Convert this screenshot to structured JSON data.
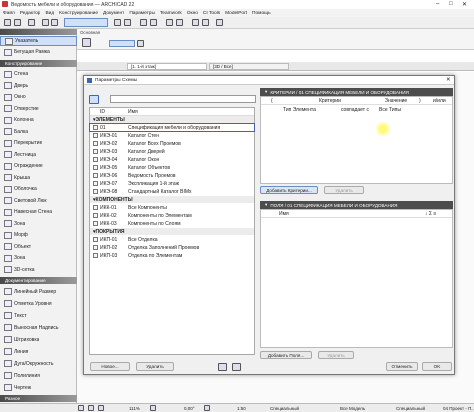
{
  "window": {
    "title": "Ведомость мебели и оборудования — ARCHICAD 22"
  },
  "menu": [
    "Файл",
    "Редактор",
    "Вид",
    "Конструирование",
    "Документ",
    "Параметры",
    "Teamwork",
    "Окно",
    "CI Tools",
    "ModelPort",
    "Помощь"
  ],
  "info_box": {
    "label": "Основная"
  },
  "tabs": [
    {
      "label": "[1. 1-й этаж]"
    },
    {
      "label": "[3D / Все]"
    }
  ],
  "toolbox": {
    "select_section": "",
    "select_items": [
      "Указатель",
      "Бегущая Рамка"
    ],
    "construct_section": "Конструирование",
    "construct_items": [
      "Стена",
      "Дверь",
      "Окно",
      "Отверстие",
      "Колонна",
      "Балка",
      "Перекрытие",
      "Лестница",
      "Ограждение",
      "Крыша",
      "Оболочка",
      "Световой Люк",
      "Навесная Стена",
      "Зона",
      "Морф",
      "Объект",
      "Зона",
      "3D-сетка"
    ],
    "document_section": "Документирование",
    "document_items": [
      "Линейный Размер",
      "Отметка Уровня",
      "Текст",
      "Выносная Надпись",
      "Штриховка",
      "Линия",
      "Дуга/Окружность",
      "Полилиния",
      "Чертеж"
    ],
    "more_label": "Разное"
  },
  "dialog": {
    "title": "Параметры Схемы",
    "left": {
      "col_id": "ID",
      "col_name": "Имя",
      "groups": [
        {
          "label": "ЭЛЕМЕНТЫ",
          "rows": [
            [
              "01",
              "Спецификация мебели и оборудования"
            ],
            [
              "ИКЭ-01",
              "Каталог Стен"
            ],
            [
              "ИКЭ-02",
              "Каталог Всех Проемов"
            ],
            [
              "ИКЭ-03",
              "Каталог Дверей"
            ],
            [
              "ИКЭ-04",
              "Каталог Окон"
            ],
            [
              "ИКЭ-05",
              "Каталог Объектов"
            ],
            [
              "ИКЭ-06",
              "Ведомость Проемов"
            ],
            [
              "ИКЭ-07",
              "Экспликация 1-й этаж"
            ],
            [
              "ИКЭ-08",
              "Стандартный Каталог BIMx"
            ]
          ]
        },
        {
          "label": "КОМПОНЕНТЫ",
          "rows": [
            [
              "ИКК-01",
              "Все Компоненты"
            ],
            [
              "ИКК-02",
              "Компоненты по Элементам"
            ],
            [
              "ИКК-03",
              "Компоненты по Слоям"
            ]
          ]
        },
        {
          "label": "ПОКРЫТИЯ",
          "rows": [
            [
              "ИКП-01",
              "Все Отделка"
            ],
            [
              "ИКП-02",
              "Отделка Заполнений Проемов"
            ],
            [
              "ИКП-03",
              "Отделка по Элементам"
            ]
          ]
        }
      ],
      "new_button": "Новое...",
      "delete_button": "Удалить"
    },
    "right": {
      "criteria_title": "КРИТЕРИИ / 01 СПЕЦИФИКАЦИЯ МЕБЕЛИ И ОБОРУДОВАНИЯ",
      "criteria_headers": [
        "(",
        "Критерии",
        "Значение",
        ")",
        "и/или"
      ],
      "criteria_row": [
        "Тип Элемента",
        "совпадает с",
        "Все Типы"
      ],
      "add_criteria_button": "Добавить Критерии...",
      "delete_criteria_button": "Удалить",
      "fields_title": "ПОЛЯ / 01 СПЕЦИФИКАЦИЯ МЕБЕЛИ И ОБОРУДОВАНИЯ",
      "fields_header": "Имя",
      "fields_header_icons": "↓ Σ ≡",
      "add_fields_button": "Добавить Поля...",
      "delete_fields_button": "Удалить",
      "cancel_button": "Отменить",
      "ok_button": "OK"
    }
  },
  "status": {
    "zoom": "111%",
    "angle": "0,00°",
    "scale": "1:50",
    "layers": "Специальный",
    "model": "Все Модель",
    "view": "Специальный",
    "pen": "Специальный",
    "renovation": "04 Проект - П..."
  },
  "colors": {
    "accent": "#2f6fd6",
    "sidebar_head": "#5a5a5a",
    "dialog_head": "#4d4d4d"
  }
}
